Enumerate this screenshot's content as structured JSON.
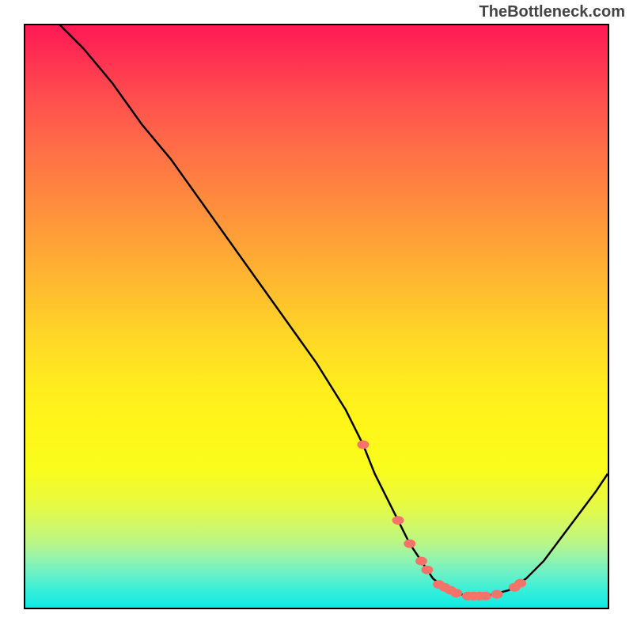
{
  "watermark": "TheBottleneck.com",
  "chart_data": {
    "type": "line",
    "title": "",
    "xlabel": "",
    "ylabel": "",
    "xlim": [
      0,
      100
    ],
    "ylim": [
      0,
      100
    ],
    "x": [
      3,
      6,
      10,
      15,
      20,
      25,
      30,
      35,
      40,
      45,
      50,
      55,
      58,
      60,
      62,
      64,
      66,
      68,
      70,
      72,
      74,
      76,
      78,
      80,
      83,
      86,
      89,
      92,
      95,
      98,
      100
    ],
    "values": [
      103,
      100,
      96,
      90,
      83,
      77,
      70,
      63,
      56,
      49,
      42,
      34,
      28,
      23,
      19,
      15,
      11,
      8,
      5,
      3.5,
      2.5,
      2,
      2,
      2.2,
      3,
      5,
      8,
      12,
      16,
      20,
      23
    ],
    "highlighted_points": {
      "x": [
        58,
        64,
        66,
        68,
        69,
        71,
        72,
        73,
        74,
        76,
        77,
        78,
        79,
        81,
        84,
        85
      ],
      "values": [
        28,
        15,
        11,
        8,
        6.5,
        4,
        3.5,
        3,
        2.5,
        2,
        2,
        2,
        2,
        2.3,
        3.5,
        4.2
      ]
    },
    "gradient_colors": {
      "top": "#ff1955",
      "middle": "#ffe820",
      "bottom": "#0aeae4"
    }
  }
}
